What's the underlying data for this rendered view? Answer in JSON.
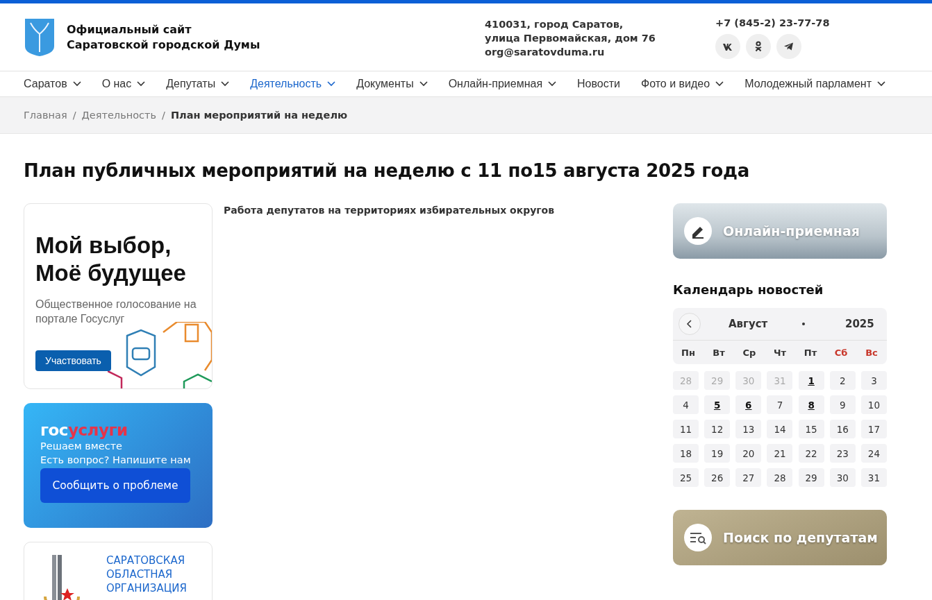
{
  "header": {
    "site_title": [
      "Официальный сайт",
      "Саратовской городской Думы"
    ],
    "address": [
      "410031, город Саратов,",
      "улица Первомайская, дом 76",
      "org@saratovduma.ru"
    ],
    "phone": "+7 (845-2) 23-77-78",
    "social": [
      {
        "kind": "vk"
      },
      {
        "kind": "ok"
      },
      {
        "kind": "telegram"
      }
    ]
  },
  "nav": [
    {
      "label": "Саратов",
      "dropdown": true,
      "selected": false
    },
    {
      "label": "О нас",
      "dropdown": true,
      "selected": false
    },
    {
      "label": "Депутаты",
      "dropdown": true,
      "selected": false
    },
    {
      "label": "Деятельность",
      "dropdown": true,
      "selected": true
    },
    {
      "label": "Документы",
      "dropdown": true,
      "selected": false
    },
    {
      "label": "Онлайн-приемная",
      "dropdown": true,
      "selected": false
    },
    {
      "label": "Новости",
      "dropdown": false,
      "selected": false
    },
    {
      "label": "Фото и видео",
      "dropdown": true,
      "selected": false
    },
    {
      "label": "Молодежный парламент",
      "dropdown": true,
      "selected": false
    }
  ],
  "breadcrumbs": [
    {
      "label": "Главная",
      "current": false
    },
    {
      "separator": "/"
    },
    {
      "label": "Деятельность",
      "current": false
    },
    {
      "separator": "/"
    },
    {
      "label": "План мероприятий на неделю",
      "current": true
    }
  ],
  "page_title": "План публичных мероприятий на неделю с 11 по15 августа 2025 года",
  "left_banners": {
    "vote": {
      "title": [
        "Мой выбор,",
        "Моё будущее"
      ],
      "text": "Общественное голосование на портале Госуслуг",
      "button": "Участвовать"
    },
    "gosuslugi": {
      "logo_part_1": "гос",
      "logo_part_2": "услуги",
      "lines": [
        "Решаем вместе",
        "Есть вопрос? Напишите нам"
      ],
      "button": "Сообщить о проблеме"
    },
    "organization": {
      "lines": [
        "САРАТОВСКАЯ",
        "ОБЛАСТНАЯ",
        "ОРГАНИЗАЦИЯ"
      ]
    }
  },
  "content": {
    "text": "Работа депутатов на территориях избирательных округов"
  },
  "right": {
    "reception_banner": "Онлайн-приемная",
    "calendar": {
      "title": "Календарь новостей",
      "month": "Август",
      "year": "2025",
      "weekdays": [
        {
          "label": "Пн",
          "weekend": false
        },
        {
          "label": "Вт",
          "weekend": false
        },
        {
          "label": "Ср",
          "weekend": false
        },
        {
          "label": "Чт",
          "weekend": false
        },
        {
          "label": "Пт",
          "weekend": false
        },
        {
          "label": "Сб",
          "weekend": true
        },
        {
          "label": "Вс",
          "weekend": true
        }
      ],
      "days": [
        {
          "label": "28",
          "muted": true,
          "linked": false
        },
        {
          "label": "29",
          "muted": true,
          "linked": false
        },
        {
          "label": "30",
          "muted": true,
          "linked": false
        },
        {
          "label": "31",
          "muted": true,
          "linked": false
        },
        {
          "label": "1",
          "muted": false,
          "linked": true
        },
        {
          "label": "2",
          "muted": false,
          "linked": false
        },
        {
          "label": "3",
          "muted": false,
          "linked": false
        },
        {
          "label": "4",
          "muted": false,
          "linked": false
        },
        {
          "label": "5",
          "muted": false,
          "linked": true
        },
        {
          "label": "6",
          "muted": false,
          "linked": true
        },
        {
          "label": "7",
          "muted": false,
          "linked": false
        },
        {
          "label": "8",
          "muted": false,
          "linked": true
        },
        {
          "label": "9",
          "muted": false,
          "linked": false
        },
        {
          "label": "10",
          "muted": false,
          "linked": false
        },
        {
          "label": "11",
          "muted": false,
          "linked": false
        },
        {
          "label": "12",
          "muted": false,
          "linked": false
        },
        {
          "label": "13",
          "muted": false,
          "linked": false
        },
        {
          "label": "14",
          "muted": false,
          "linked": false
        },
        {
          "label": "15",
          "muted": false,
          "linked": false
        },
        {
          "label": "16",
          "muted": false,
          "linked": false
        },
        {
          "label": "17",
          "muted": false,
          "linked": false
        },
        {
          "label": "18",
          "muted": false,
          "linked": false
        },
        {
          "label": "19",
          "muted": false,
          "linked": false
        },
        {
          "label": "20",
          "muted": false,
          "linked": false
        },
        {
          "label": "21",
          "muted": false,
          "linked": false
        },
        {
          "label": "22",
          "muted": false,
          "linked": false
        },
        {
          "label": "23",
          "muted": false,
          "linked": false
        },
        {
          "label": "24",
          "muted": false,
          "linked": false
        },
        {
          "label": "25",
          "muted": false,
          "linked": false
        },
        {
          "label": "26",
          "muted": false,
          "linked": false
        },
        {
          "label": "27",
          "muted": false,
          "linked": false
        },
        {
          "label": "28",
          "muted": false,
          "linked": false
        },
        {
          "label": "29",
          "muted": false,
          "linked": false
        },
        {
          "label": "30",
          "muted": false,
          "linked": false
        },
        {
          "label": "31",
          "muted": false,
          "linked": false
        }
      ]
    },
    "search_banner": "Поиск по депутатам"
  }
}
